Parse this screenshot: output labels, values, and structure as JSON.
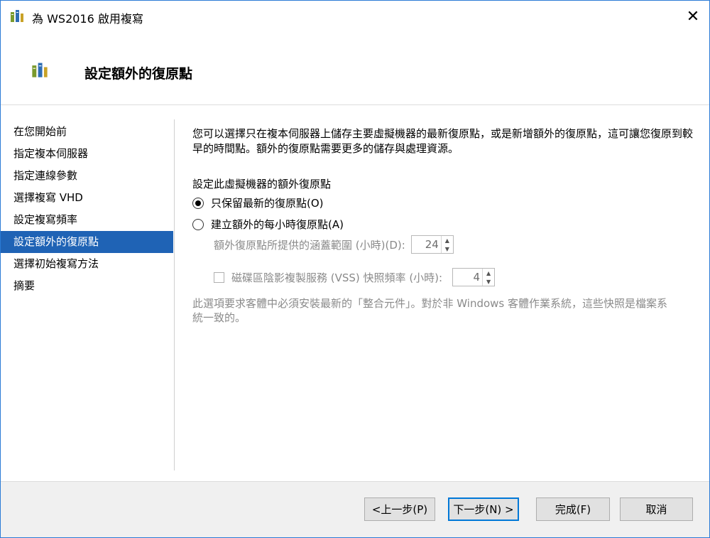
{
  "window": {
    "title": "為 WS2016 啟用複寫",
    "close_glyph": "✕"
  },
  "header": {
    "title": "設定額外的復原點"
  },
  "nav": {
    "items": [
      {
        "label": "在您開始前",
        "active": false
      },
      {
        "label": "指定複本伺服器",
        "active": false
      },
      {
        "label": "指定連線參數",
        "active": false
      },
      {
        "label": "選擇複寫 VHD",
        "active": false
      },
      {
        "label": "設定複寫頻率",
        "active": false
      },
      {
        "label": "設定額外的復原點",
        "active": true
      },
      {
        "label": "選擇初始複寫方法",
        "active": false
      },
      {
        "label": "摘要",
        "active": false
      }
    ]
  },
  "content": {
    "intro": "您可以選擇只在複本伺服器上儲存主要虛擬機器的最新復原點，或是新增額外的復原點，這可讓您復原到較早的時間點。額外的復原點需要更多的儲存與處理資源。",
    "section_label": "設定此虛擬機器的額外復原點",
    "radio_latest": {
      "label": "只保留最新的復原點(O)",
      "checked": true
    },
    "radio_hourly": {
      "label": "建立額外的每小時復原點(A)",
      "checked": false
    },
    "coverage": {
      "label": "額外復原點所提供的涵蓋範圍 (小時)(D):",
      "value": "24"
    },
    "vss": {
      "label": "磁碟區陰影複製服務 (VSS) 快照頻率 (小時):",
      "value": "4",
      "checked": false
    },
    "note": "此選項要求客體中必須安裝最新的「整合元件」。對於非 Windows 客體作業系統，這些快照是檔案系統一致的。"
  },
  "footer": {
    "prev": "<上一步(P)",
    "next": "下一步(N) >",
    "finish": "完成(F)",
    "cancel": "取消"
  },
  "colors": {
    "accent": "#1f63b5",
    "window_border": "#2b7bd6",
    "footer_bg": "#f0f0f0"
  }
}
